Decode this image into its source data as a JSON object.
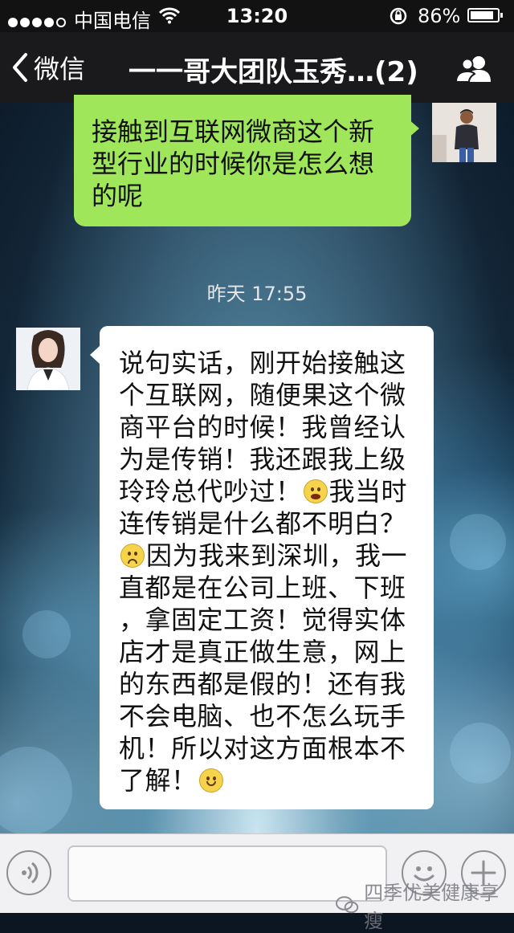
{
  "status_bar": {
    "carrier": "中国电信",
    "time": "13:20",
    "battery_percent_text": "86%",
    "battery_level": 0.86
  },
  "nav": {
    "back_label": "微信",
    "title": "一一哥大团队玉秀…(2)"
  },
  "messages": [
    {
      "direction": "sent",
      "lines": [
        "接触到互联网微商这个新",
        "型行业的时候你是怎么想",
        "的呢"
      ]
    },
    {
      "direction": "timestamp",
      "text": "昨天 17:55"
    },
    {
      "direction": "received",
      "segments": [
        "说句实话，刚开始接触这",
        "个互联网，随便果这个微",
        "商平台的时候！我曾经认",
        "为是传销！我还跟我上级",
        "玲玲总代吵过！",
        "我当时",
        "连传销是什么都不明白？",
        "因为我来到深圳，我一",
        "直都是在公司上班、下班",
        "，拿固定工资！觉得实体",
        "店才是真正做生意，网上",
        "的东西都是假的！还有我",
        "不会电脑、也不怎么玩手",
        "机！所以对这方面根本不",
        "了解！"
      ],
      "emojis": [
        "anguished-face-icon",
        "sad-face-icon",
        "smile-face-icon"
      ]
    }
  ],
  "watermark": "四季优美健康享瘦",
  "colors": {
    "sent_bubble": "#9fe65a",
    "received_bubble": "#ffffff",
    "nav_background": "#1a1a1c"
  }
}
